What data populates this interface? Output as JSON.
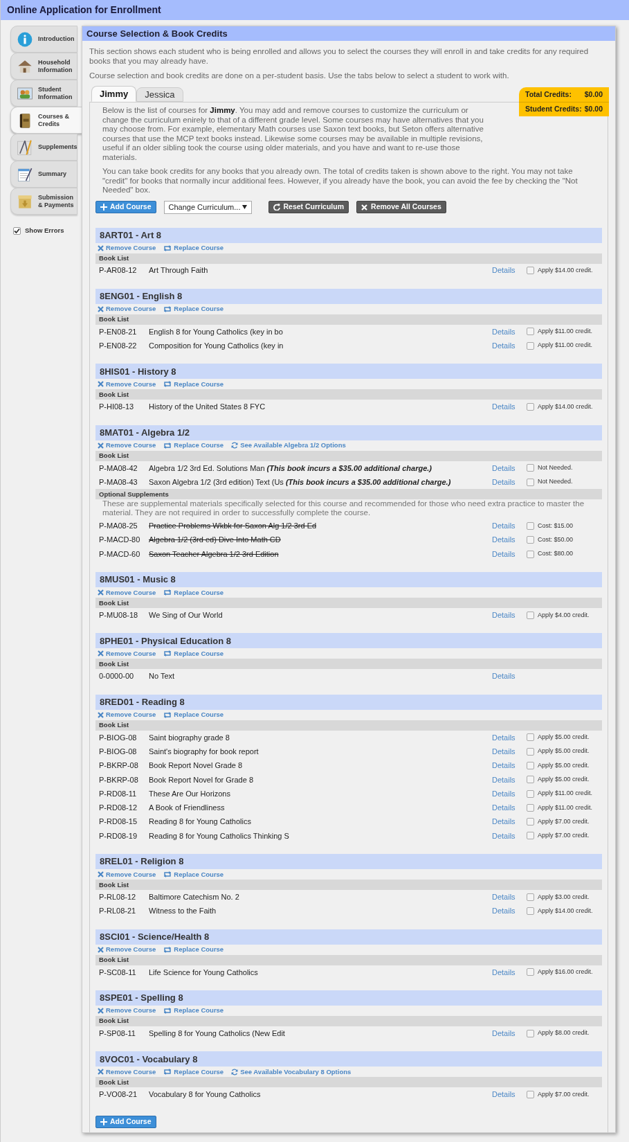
{
  "window": {
    "title": "Online Application for Enrollment"
  },
  "sidebar": {
    "items": [
      {
        "label": "Introduction",
        "selected": false
      },
      {
        "label": "Household Information",
        "selected": false
      },
      {
        "label": "Student Information",
        "selected": false
      },
      {
        "label": "Courses & Credits",
        "selected": true
      },
      {
        "label": "Supplements",
        "selected": false
      },
      {
        "label": "Summary",
        "selected": false
      },
      {
        "label": "Submission & Payments",
        "selected": false
      }
    ],
    "show_errors": {
      "label": "Show Errors",
      "checked": true
    }
  },
  "panel": {
    "title": "Course Selection & Book Credits",
    "intro": [
      "This section shows each student who is being enrolled and allows you to select the courses they will enroll in and take credits for any required books that you may already have.",
      "Course selection and book credits are done on a per-student basis. Use the tabs below to select a student to work with."
    ],
    "tabs": [
      {
        "label": "Jimmy",
        "selected": true
      },
      {
        "label": "Jessica",
        "selected": false
      }
    ],
    "credits": [
      {
        "label": "Total Credits:",
        "value": "$0.00"
      },
      {
        "label": "Student Credits:",
        "value": "$0.00"
      }
    ],
    "description": [
      "Below is the list of courses for **Jimmy**. You may add and remove courses to customize the curriculum or change the curriculum enirely to that of a different grade level. Some courses may have alternatives that you may choose from. For example, elementary Math courses use Saxon text books, but Seton offers alternative courses that use the MCP text books instead. Likewise some courses may be available in multiple revisions, useful if an older sibling took the course using older materials, and you have and want to re-use those materials.",
      "You can take book credits for any books that you already own. The total of credits taken is shown above to the right. You may not take \"credit\" for books that normally incur additional fees. However, if you already have the book, you can avoid the fee by checking the \"Not Needed\" box."
    ],
    "toolbar": {
      "add": "Add Course",
      "select": "Change Curriculum...",
      "reset": "Reset Curriculum",
      "remove_all": "Remove All Courses"
    },
    "courses": [
      {
        "title": "8ART01 - Art 8",
        "actions": [
          {
            "kind": "remove",
            "label": "Remove Course"
          },
          {
            "kind": "replace",
            "label": "Replace Course"
          }
        ],
        "sections": [
          {
            "heading": "Book List",
            "items": [
              {
                "code": "P-AR08-12",
                "title": "Art Through Faith",
                "struck": false,
                "link": "Details",
                "option": "Apply $14.00 credit.",
                "checked": false
              }
            ]
          }
        ]
      },
      {
        "title": "8ENG01 - English 8",
        "actions": [
          {
            "kind": "remove",
            "label": "Remove Course"
          },
          {
            "kind": "replace",
            "label": "Replace Course"
          }
        ],
        "sections": [
          {
            "heading": "Book List",
            "items": [
              {
                "code": "P-EN08-21",
                "title": "English 8 for Young Catholics (key in bo",
                "struck": false,
                "link": "Details",
                "option": "Apply $11.00 credit.",
                "checked": false
              },
              {
                "code": "P-EN08-22",
                "title": "Composition for Young Catholics (key in",
                "struck": false,
                "link": "Details",
                "option": "Apply $11.00 credit.",
                "checked": false
              }
            ]
          }
        ]
      },
      {
        "title": "8HIS01 - History 8",
        "actions": [
          {
            "kind": "remove",
            "label": "Remove Course"
          },
          {
            "kind": "replace",
            "label": "Replace Course"
          }
        ],
        "sections": [
          {
            "heading": "Book List",
            "items": [
              {
                "code": "P-HI08-13",
                "title": "History of the United States 8 FYC",
                "struck": false,
                "link": "Details",
                "option": "Apply $14.00 credit.",
                "checked": false
              }
            ]
          }
        ]
      },
      {
        "title": "8MAT01 - Algebra 1/2",
        "actions": [
          {
            "kind": "remove",
            "label": "Remove Course"
          },
          {
            "kind": "replace",
            "label": "Replace Course"
          },
          {
            "kind": "options",
            "label": "See Available Algebra 1/2 Options"
          }
        ],
        "sections": [
          {
            "heading": "Book List",
            "items": [
              {
                "code": "P-MA08-42",
                "title": "Algebra 1/2 3rd Ed. Solutions Man",
                "note": "(This book incurs a $35.00 additional charge.)",
                "struck": false,
                "link": "Details",
                "option": "Not Needed.",
                "checked": false
              },
              {
                "code": "P-MA08-43",
                "title": "Saxon Algebra 1/2 (3rd edition) Text (Us",
                "note": "(This book incurs a $35.00 additional charge.)",
                "struck": false,
                "link": "Details",
                "option": "Not Needed.",
                "checked": false
              }
            ]
          },
          {
            "heading": "Optional Supplements",
            "text": "These are supplemental materials specifically selected for this course and recommended for those who need extra practice to master the material. They are not required in order to successfully complete the course.",
            "items": [
              {
                "code": "P-MA08-25",
                "title": "Practice Problems Wkbk for Saxon Alg 1/2 3rd Ed",
                "struck": true,
                "link": "Details",
                "option": "Cost: $15.00",
                "checked": false
              },
              {
                "code": "P-MACD-80",
                "title": "Algebra 1/2 (3rd ed) Dive Into Math CD",
                "struck": true,
                "link": "Details",
                "option": "Cost: $50.00",
                "checked": false
              },
              {
                "code": "P-MACD-60",
                "title": "Saxon Teacher Algebra 1/2 3rd Edition",
                "struck": true,
                "link": "Details",
                "option": "Cost: $80.00",
                "checked": false
              }
            ]
          }
        ]
      },
      {
        "title": "8MUS01 - Music 8",
        "actions": [
          {
            "kind": "remove",
            "label": "Remove Course"
          },
          {
            "kind": "replace",
            "label": "Replace Course"
          }
        ],
        "sections": [
          {
            "heading": "Book List",
            "items": [
              {
                "code": "P-MU08-18",
                "title": "We Sing of Our World",
                "struck": false,
                "link": "Details",
                "option": "Apply $4.00 credit.",
                "checked": false
              }
            ]
          }
        ]
      },
      {
        "title": "8PHE01 - Physical Education 8",
        "actions": [
          {
            "kind": "remove",
            "label": "Remove Course"
          },
          {
            "kind": "replace",
            "label": "Replace Course"
          }
        ],
        "sections": [
          {
            "heading": "Book List",
            "items": [
              {
                "code": "0-0000-00",
                "title": "No Text",
                "struck": false,
                "link": "Details"
              }
            ]
          }
        ]
      },
      {
        "title": "8RED01 - Reading 8",
        "actions": [
          {
            "kind": "remove",
            "label": "Remove Course"
          },
          {
            "kind": "replace",
            "label": "Replace Course"
          }
        ],
        "sections": [
          {
            "heading": "Book List",
            "items": [
              {
                "code": "P-BIOG-08",
                "title": "Saint biography grade 8",
                "struck": false,
                "link": "Details",
                "option": "Apply $5.00 credit.",
                "checked": false
              },
              {
                "code": "P-BIOG-08",
                "title": "Saint's biography for book report",
                "struck": false,
                "link": "Details",
                "option": "Apply $5.00 credit.",
                "checked": false
              },
              {
                "code": "P-BKRP-08",
                "title": "Book Report Novel Grade 8",
                "struck": false,
                "link": "Details",
                "option": "Apply $5.00 credit.",
                "checked": false
              },
              {
                "code": "P-BKRP-08",
                "title": "Book Report Novel for Grade 8",
                "struck": false,
                "link": "Details",
                "option": "Apply $5.00 credit.",
                "checked": false
              },
              {
                "code": "P-RD08-11",
                "title": "These Are Our Horizons",
                "struck": false,
                "link": "Details",
                "option": "Apply $11.00 credit.",
                "checked": false
              },
              {
                "code": "P-RD08-12",
                "title": "A Book of Friendliness",
                "struck": false,
                "link": "Details",
                "option": "Apply $11.00 credit.",
                "checked": false
              },
              {
                "code": "P-RD08-15",
                "title": "Reading 8 for Young Catholics",
                "struck": false,
                "link": "Details",
                "option": "Apply $7.00 credit.",
                "checked": false
              },
              {
                "code": "P-RD08-19",
                "title": "Reading 8 for Young Catholics Thinking S",
                "struck": false,
                "link": "Details",
                "option": "Apply $7.00 credit.",
                "checked": false
              }
            ]
          }
        ]
      },
      {
        "title": "8REL01 - Religion 8",
        "actions": [
          {
            "kind": "remove",
            "label": "Remove Course"
          },
          {
            "kind": "replace",
            "label": "Replace Course"
          }
        ],
        "sections": [
          {
            "heading": "Book List",
            "items": [
              {
                "code": "P-RL08-12",
                "title": "Baltimore Catechism No. 2",
                "struck": false,
                "link": "Details",
                "option": "Apply $3.00 credit.",
                "checked": false
              },
              {
                "code": "P-RL08-21",
                "title": "Witness to the Faith",
                "struck": false,
                "link": "Details",
                "option": "Apply $14.00 credit.",
                "checked": false
              }
            ]
          }
        ]
      },
      {
        "title": "8SCI01 - Science/Health 8",
        "actions": [
          {
            "kind": "remove",
            "label": "Remove Course"
          },
          {
            "kind": "replace",
            "label": "Replace Course"
          }
        ],
        "sections": [
          {
            "heading": "Book List",
            "items": [
              {
                "code": "P-SC08-11",
                "title": "Life Science for Young Catholics",
                "struck": false,
                "link": "Details",
                "option": "Apply $16.00 credit.",
                "checked": false
              }
            ]
          }
        ]
      },
      {
        "title": "8SPE01 - Spelling 8",
        "actions": [
          {
            "kind": "remove",
            "label": "Remove Course"
          },
          {
            "kind": "replace",
            "label": "Replace Course"
          }
        ],
        "sections": [
          {
            "heading": "Book List",
            "items": [
              {
                "code": "P-SP08-11",
                "title": "Spelling 8 for Young Catholics (New Edit",
                "struck": false,
                "link": "Details",
                "option": "Apply $8.00 credit.",
                "checked": false
              }
            ]
          }
        ]
      },
      {
        "title": "8VOC01 - Vocabulary 8",
        "actions": [
          {
            "kind": "remove",
            "label": "Remove Course"
          },
          {
            "kind": "replace",
            "label": "Replace Course"
          },
          {
            "kind": "options",
            "label": "See Available Vocabulary 8 Options"
          }
        ],
        "sections": [
          {
            "heading": "Book List",
            "items": [
              {
                "code": "P-VO08-21",
                "title": "Vocabulary 8 for Young Catholics",
                "struck": false,
                "link": "Details",
                "option": "Apply $7.00 credit.",
                "checked": false
              }
            ]
          }
        ]
      }
    ],
    "bottom_button": "Add Course"
  }
}
